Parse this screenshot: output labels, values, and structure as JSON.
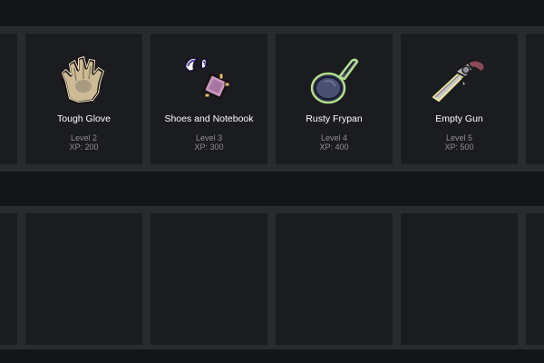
{
  "items": [
    {
      "name": "Tough Glove",
      "level": "Level 2",
      "xp": "XP: 200",
      "icon": "glove-icon"
    },
    {
      "name": "Shoes and Notebook",
      "level": "Level 3",
      "xp": "XP: 300",
      "icon": "shoes-notebook-icon"
    },
    {
      "name": "Rusty Frypan",
      "level": "Level 4",
      "xp": "XP: 400",
      "icon": "frypan-icon"
    },
    {
      "name": "Empty Gun",
      "level": "Level 5",
      "xp": "XP: 500",
      "icon": "gun-icon"
    }
  ],
  "colors": {
    "background": "#151618",
    "band": "#2a2b2e",
    "cell": "#1b1c1f",
    "text": "#ffffff",
    "subtext": "#8e8f93"
  }
}
